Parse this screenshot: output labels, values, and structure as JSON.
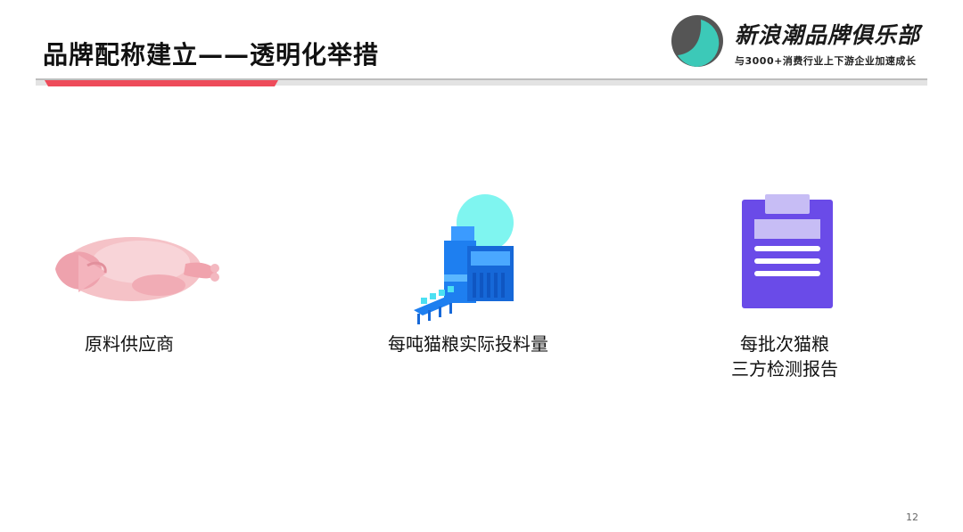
{
  "slide": {
    "title": "品牌配称建立——透明化举措",
    "page_number": "12"
  },
  "logo": {
    "name": "新浪潮品牌俱乐部",
    "tagline": "与3000+消费行业上下游企业加速成长"
  },
  "items": [
    {
      "icon": "raw-chicken-icon",
      "caption_lines": [
        "原料供应商"
      ]
    },
    {
      "icon": "factory-production-icon",
      "caption_lines": [
        "每吨猫粮实际投料量"
      ]
    },
    {
      "icon": "clipboard-report-icon",
      "caption_lines": [
        "每批次猫粮",
        "三方检测报告"
      ]
    }
  ],
  "colors": {
    "accent_red": "#ee4b5a",
    "divider_gray": "#cfcfcf",
    "logo_dark": "#555555",
    "logo_teal": "#3cc9b8",
    "clipboard_purple": "#6a4be8",
    "factory_blue": "#1e7ff0"
  }
}
